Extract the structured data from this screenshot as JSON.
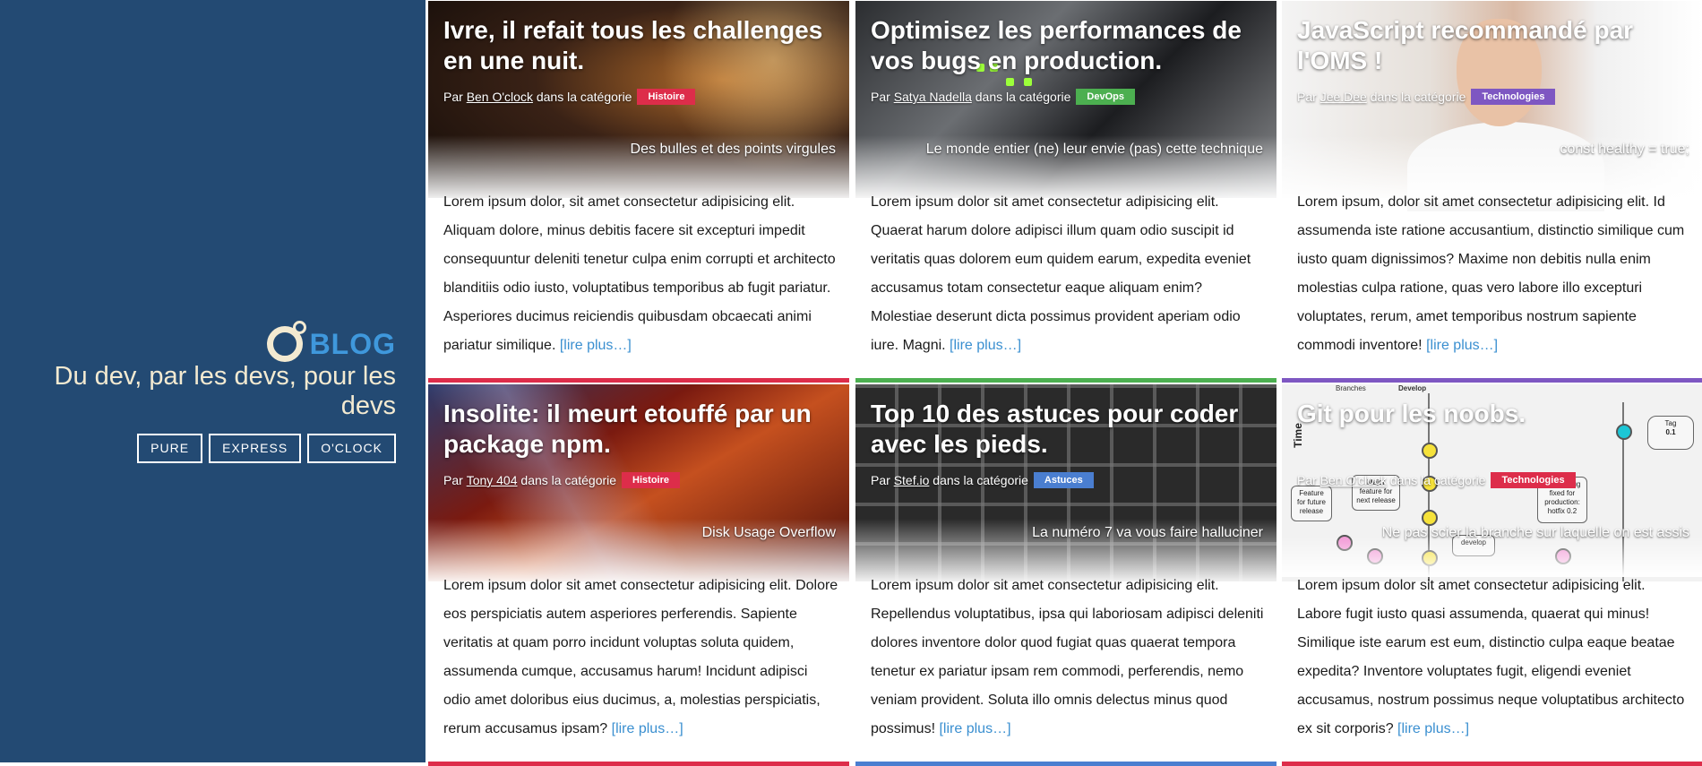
{
  "brand": {
    "logo_text": "BLOG",
    "tagline": "Du dev, par les devs, pour les devs"
  },
  "nav": {
    "items": [
      {
        "label": "PURE"
      },
      {
        "label": "EXPRESS"
      },
      {
        "label": "O'CLOCK"
      }
    ]
  },
  "meta_labels": {
    "by": "Par",
    "in_category": "dans la catégorie",
    "read_more": "[lire plus…]"
  },
  "colors": {
    "sidebar": "#234a73",
    "histoire": "#dd2d4a",
    "devops": "#4caf50",
    "technologies_purple": "#7e57c2",
    "astuces": "#4a7ed0",
    "link": "#3a8fd0"
  },
  "articles": [
    {
      "title": "Ivre, il refait tous les challenges en une nuit.",
      "author": "Ben O'clock",
      "category": "Histoire",
      "category_color": "#dd2d4a",
      "subtitle": "Des bulles et des points virgules",
      "excerpt": "Lorem ipsum dolor, sit amet consectetur adipisicing elit. Aliquam dolore, minus debitis facere sit excepturi impedit consequuntur deleniti tenetur culpa enim corrupti et architecto blanditiis odio iusto, voluptatibus temporibus ab fugit pariatur. Asperiores ducimus reiciendis quibusdam obcaecati animi pariatur similique.",
      "hero": "server-room-lights"
    },
    {
      "title": "Optimisez les performances de vos bugs en production.",
      "author": "Satya Nadella",
      "category": "DevOps",
      "category_color": "#4caf50",
      "subtitle": "Le monde entier (ne) leur envie (pas) cette technique",
      "excerpt": "Lorem ipsum dolor sit amet consectetur adipisicing elit. Quaerat harum dolore adipisci illum quam odio suscipit id veritatis quas dolorem eum quidem earum, expedita eveniet accusamus totam consectetur eaque aliquam enim? Molestiae deserunt dicta possimus provident aperiam odio iure. Magni.",
      "hero": "server-rack"
    },
    {
      "title": "JavaScript recommandé par l'OMS !",
      "author": "Jee.Dee",
      "category": "Technologies",
      "category_color": "#7e57c2",
      "subtitle": "const healthy = true;",
      "excerpt": "Lorem ipsum, dolor sit amet consectetur adipisicing elit. Id assumenda iste ratione accusantium, distinctio similique cum iusto quam dignissimos? Maxime non debitis nulla enim molestias culpa ratione, quas vero labore illo excepturi voluptates, rerum, amet temporibus nostrum sapiente commodi inventore!",
      "hero": "doctor"
    },
    {
      "title": "Insolite: il meurt etouffé par un package npm.",
      "author": "Tony 404",
      "category": "Histoire",
      "category_color": "#dd2d4a",
      "subtitle": "Disk Usage Overflow",
      "excerpt": "Lorem ipsum dolor sit amet consectetur adipisicing elit. Dolore eos perspiciatis autem asperiores perferendis. Sapiente veritatis at quam porro incidunt voluptas soluta quidem, assumenda cumque, accusamus harum! Incidunt adipisci odio amet doloribus eius ducimus, a, molestias perspiciatis, rerum accusamus ipsam?",
      "hero": "red-abstract"
    },
    {
      "title": "Top 10 des astuces pour coder avec les pieds.",
      "author": "Stef.io",
      "category": "Astuces",
      "category_color": "#4a7ed0",
      "subtitle": "La numéro 7 va vous faire halluciner",
      "excerpt": "Lorem ipsum dolor sit amet consectetur adipisicing elit. Repellendus voluptatibus, ipsa qui laboriosam adipisci deleniti dolores inventore dolor quod fugiat quas quaerat tempora tenetur ex pariatur ipsam rem commodi, perferendis, nemo veniam provident. Soluta illo omnis delectus minus quod possimus!",
      "hero": "keyboard"
    },
    {
      "title": "Git pour les noobs.",
      "author": "Ben O'clock",
      "category": "Technologies",
      "category_color": "#dd2d4a",
      "subtitle": "Ne pas scier la branche sur laquelle on est assis",
      "excerpt": "Lorem ipsum dolor sit amet consectetur adipisicing elit. Labore fugit iusto quasi assumenda, quaerat qui minus! Similique iste earum est eum, distinctio culpa eaque beatae expedita? Inventore voluptates fugit, eligendi eveniet accusamus, nostrum possimus neque voluptatibus architecto ex sit corporis?",
      "hero": "git-diagram",
      "diagram_labels": {
        "time": "Time",
        "tag": "Tag",
        "tag_value": "0.1",
        "feature_future": "Feature for future release",
        "major_feature": "Major feature for next release",
        "severe_bug": "Severe bug fixed for production: hotfix 0.2",
        "develop": "develop",
        "branches": "Branches",
        "develop_head": "Develop"
      }
    }
  ]
}
